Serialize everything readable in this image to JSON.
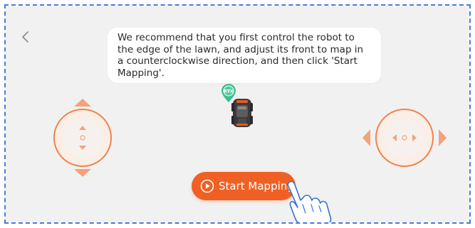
{
  "instruction": {
    "text": "We recommend that you first control the robot to the edge of the lawn, and adjust its front to map in a counterclockwise direction, and then click 'Start Mapping'."
  },
  "rtk_badge": {
    "label": "RTK"
  },
  "start_button": {
    "label": "Start Mapping"
  },
  "icons": {
    "back": "chevron-left-icon",
    "play": "play-circle-icon",
    "hand": "tap-hand-icon",
    "robot": "robot-mower-icon",
    "rtk": "map-pin-icon"
  },
  "colors": {
    "accent": "#f06024",
    "ring": "#f0834a",
    "rtk_green": "#3cc08f",
    "background": "#f1f1f1",
    "frame": "#4a7ae0"
  }
}
